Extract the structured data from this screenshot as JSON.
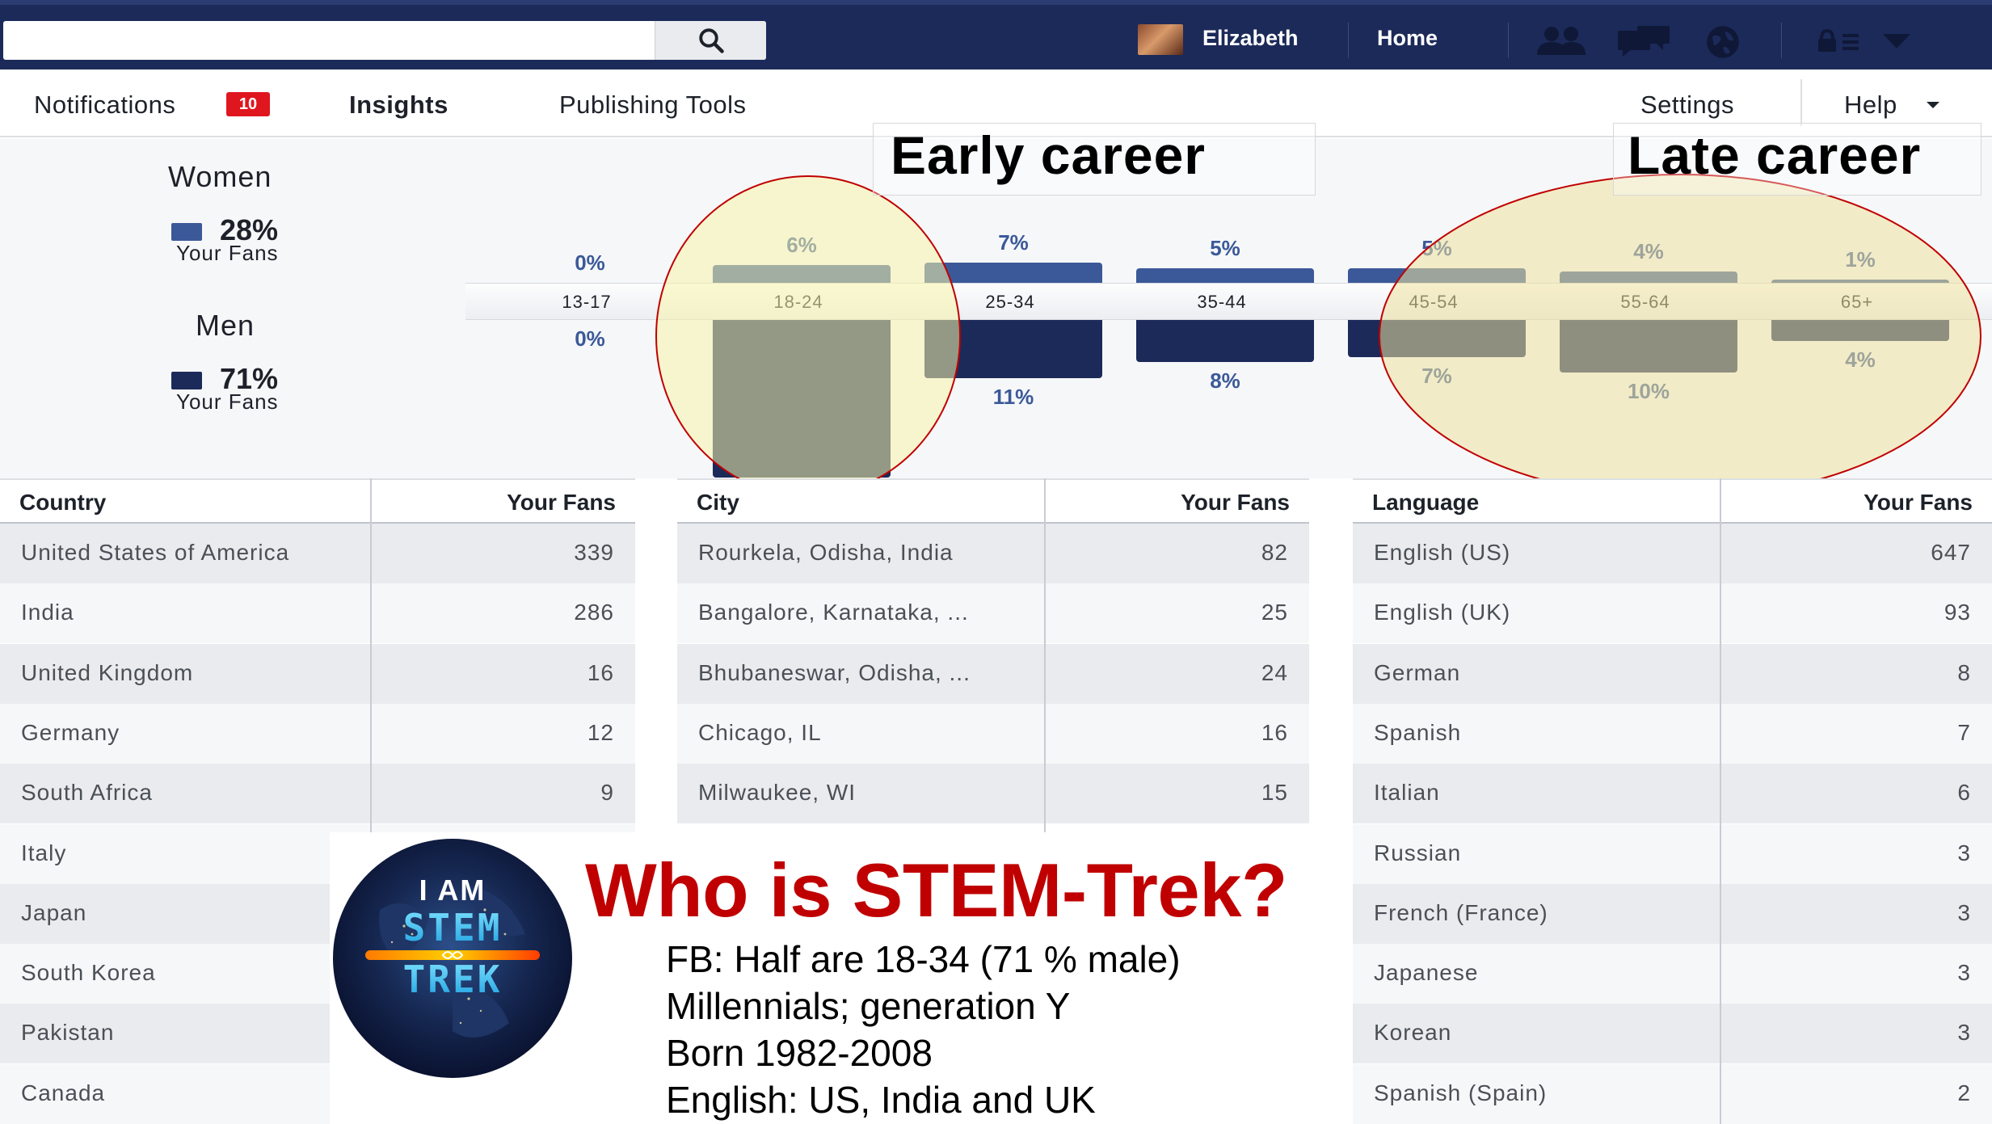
{
  "topbar": {
    "search_placeholder": "",
    "user_name": "Elizabeth",
    "home_label": "Home"
  },
  "tabs": {
    "notifications_label": "Notifications",
    "notifications_count": "10",
    "insights_label": "Insights",
    "publishing_label": "Publishing Tools",
    "settings_label": "Settings",
    "help_label": "Help"
  },
  "demographics": {
    "women_title": "Women",
    "women_pct": "28%",
    "women_sub": "Your Fans",
    "men_title": "Men",
    "men_pct": "71%",
    "men_sub": "Your Fans",
    "colors": {
      "women": "#3b5998",
      "men": "#1c2a5a"
    },
    "age_groups": [
      {
        "label": "13-17",
        "women": "0%",
        "men": "0%",
        "women_value": 0,
        "men_value": 0
      },
      {
        "label": "18-24",
        "women": "6%",
        "men": "30%",
        "women_value": 6,
        "men_value": 30
      },
      {
        "label": "25-34",
        "women": "7%",
        "men": "11%",
        "women_value": 7,
        "men_value": 11
      },
      {
        "label": "35-44",
        "women": "5%",
        "men": "8%",
        "women_value": 5,
        "men_value": 8
      },
      {
        "label": "45-54",
        "women": "5%",
        "men": "7%",
        "women_value": 5,
        "men_value": 7
      },
      {
        "label": "55-64",
        "women": "4%",
        "men": "10%",
        "women_value": 4,
        "men_value": 10
      },
      {
        "label": "65+",
        "women": "1%",
        "men": "4%",
        "women_value": 1,
        "men_value": 4
      }
    ]
  },
  "annotations": {
    "early": "Early career",
    "late": "Late career"
  },
  "tables": {
    "country": {
      "header": "Country",
      "value_header": "Your Fans",
      "rows": [
        {
          "name": "United States of America",
          "value": "339"
        },
        {
          "name": "India",
          "value": "286"
        },
        {
          "name": "United Kingdom",
          "value": "16"
        },
        {
          "name": "Germany",
          "value": "12"
        },
        {
          "name": "South Africa",
          "value": "9"
        },
        {
          "name": "Italy",
          "value": ""
        },
        {
          "name": "Japan",
          "value": ""
        },
        {
          "name": "South Korea",
          "value": ""
        },
        {
          "name": "Pakistan",
          "value": ""
        },
        {
          "name": "Canada",
          "value": ""
        }
      ]
    },
    "city": {
      "header": "City",
      "value_header": "Your Fans",
      "rows": [
        {
          "name": "Rourkela, Odisha, India",
          "value": "82"
        },
        {
          "name": "Bangalore, Karnataka, ...",
          "value": "25"
        },
        {
          "name": "Bhubaneswar, Odisha, ...",
          "value": "24"
        },
        {
          "name": "Chicago, IL",
          "value": "16"
        },
        {
          "name": "Milwaukee, WI",
          "value": "15"
        }
      ]
    },
    "language": {
      "header": "Language",
      "value_header": "Your Fans",
      "rows": [
        {
          "name": "English (US)",
          "value": "647"
        },
        {
          "name": "English (UK)",
          "value": "93"
        },
        {
          "name": "German",
          "value": "8"
        },
        {
          "name": "Spanish",
          "value": "7"
        },
        {
          "name": "Italian",
          "value": "6"
        },
        {
          "name": "Russian",
          "value": "3"
        },
        {
          "name": "French (France)",
          "value": "3"
        },
        {
          "name": "Japanese",
          "value": "3"
        },
        {
          "name": "Korean",
          "value": "3"
        },
        {
          "name": "Spanish (Spain)",
          "value": "2"
        }
      ]
    }
  },
  "overlay": {
    "logo_line1": "I AM",
    "logo_line2": "STEM",
    "logo_line3": "TREK",
    "title": "Who is STEM-Trek?",
    "lines": [
      "FB: Half are 18-34  (71 % male)",
      "Millennials; generation Y",
      "Born 1982-2008",
      "English: US, India and UK"
    ]
  }
}
